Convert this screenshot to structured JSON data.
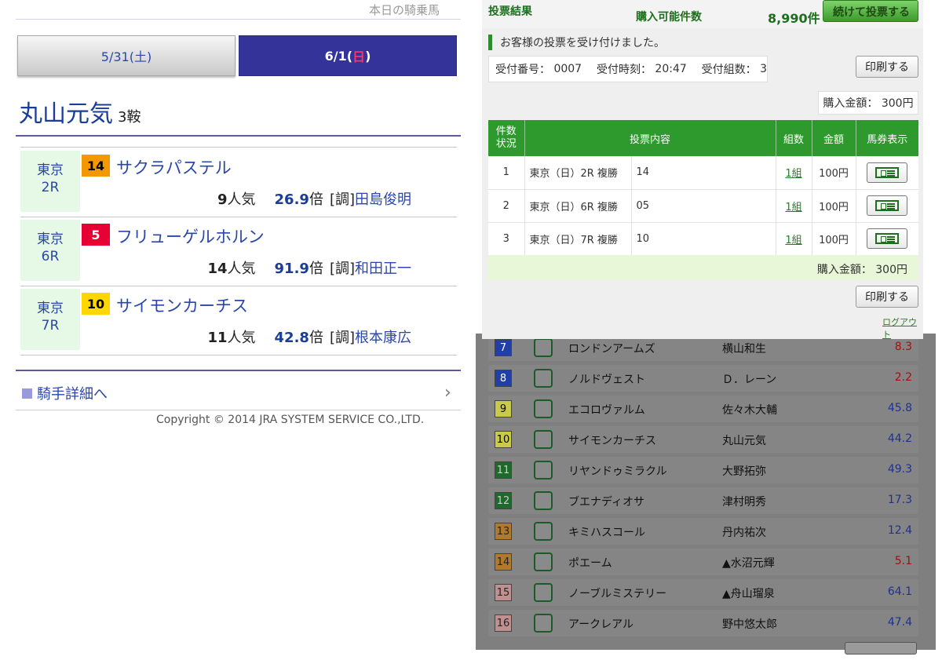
{
  "left": {
    "top_cut_text": "本日の騎乗馬",
    "tabs": [
      {
        "label": "5/31(土)"
      },
      {
        "label_pre": "6/1(",
        "label_day": "日",
        "label_post": ")"
      }
    ],
    "jockey": {
      "name": "丸山元気",
      "mounts": "3鞍"
    },
    "races": [
      {
        "track": "東京",
        "race": "2R",
        "num": "14",
        "num_bg": "#f39800",
        "num_fg": "#000000",
        "horse": "サクラパステル",
        "pop": "9",
        "pop_unit": "人気",
        "odds": "26.9",
        "odds_unit": "倍",
        "trainer_tag": "[調]",
        "trainer": "田島俊明"
      },
      {
        "track": "東京",
        "race": "6R",
        "num": "5",
        "num_bg": "#e60033",
        "num_fg": "#ffffff",
        "horse": "フリューゲルホルン",
        "pop": "14",
        "pop_unit": "人気",
        "odds": "91.9",
        "odds_unit": "倍",
        "trainer_tag": "[調]",
        "trainer": "和田正一"
      },
      {
        "track": "東京",
        "race": "7R",
        "num": "10",
        "num_bg": "#ffd700",
        "num_fg": "#000000",
        "horse": "サイモンカーチス",
        "pop": "11",
        "pop_unit": "人気",
        "odds": "42.8",
        "odds_unit": "倍",
        "trainer_tag": "[調]",
        "trainer": "根本康広"
      }
    ],
    "detail_link": "騎手詳細へ",
    "copyright": "Copyright © 2014 JRA SYSTEM SERVICE CO.,LTD."
  },
  "modal": {
    "title": "投票結果",
    "avail_label": "購入可能件数",
    "avail_value": "8,990件",
    "continue_label": "続けて投票する",
    "accept_msg": "お客様の投票を受け付けました。",
    "receipt": {
      "no_label": "受付番号：",
      "no": "0007",
      "time_label": "受付時刻：",
      "time": "20:47",
      "sets_label": "受付組数：",
      "sets": "3"
    },
    "print_label": "印刷する",
    "total_top": "購入金額： 300円",
    "headers": {
      "status": "件数\n状況",
      "content": "投票内容",
      "units": "組数",
      "amount": "金額",
      "ticket": "馬券表示"
    },
    "bets": [
      {
        "n": "1",
        "race": "東京（日）2R 複勝",
        "sel": "14",
        "units": "1組",
        "amount": "100円"
      },
      {
        "n": "2",
        "race": "東京（日）6R 複勝",
        "sel": "05",
        "units": "1組",
        "amount": "100円"
      },
      {
        "n": "3",
        "race": "東京（日）7R 複勝",
        "sel": "10",
        "units": "1組",
        "amount": "100円"
      }
    ],
    "total_bottom": "購入金額： 300円",
    "print_label2": "印刷する",
    "logout": "ログアウト"
  },
  "bg_rows": [
    {
      "num": "7",
      "num_bg": "#2040a8",
      "num_fg": "#ffffff",
      "horse": "ロンドンアームズ",
      "jockey": "横山和生",
      "odds": "8.3",
      "odds_color": "#a01010"
    },
    {
      "num": "8",
      "num_bg": "#2040a8",
      "num_fg": "#ffffff",
      "horse": "ノルドヴェスト",
      "jockey": "Ｄ．レーン",
      "odds": "2.2",
      "odds_color": "#a01010"
    },
    {
      "num": "9",
      "num_bg": "#c9c94a",
      "num_fg": "#000000",
      "horse": "エコロヴァルム",
      "jockey": "佐々木大輔",
      "odds": "45.8",
      "odds_color": "#203090"
    },
    {
      "num": "10",
      "num_bg": "#c9c94a",
      "num_fg": "#000000",
      "horse": "サイモンカーチス",
      "jockey": "丸山元気",
      "odds": "44.2",
      "odds_color": "#203090"
    },
    {
      "num": "11",
      "num_bg": "#1e6a2a",
      "num_fg": "#cccccc",
      "horse": "リヤンドゥミラクル",
      "jockey": "大野拓弥",
      "odds": "49.3",
      "odds_color": "#203090"
    },
    {
      "num": "12",
      "num_bg": "#1e6a2a",
      "num_fg": "#cccccc",
      "horse": "ブエナディオサ",
      "jockey": "津村明秀",
      "odds": "17.3",
      "odds_color": "#203090"
    },
    {
      "num": "13",
      "num_bg": "#b07a2a",
      "num_fg": "#222222",
      "horse": "キミハスコール",
      "jockey": "丹内祐次",
      "odds": "12.4",
      "odds_color": "#203090"
    },
    {
      "num": "14",
      "num_bg": "#b07a2a",
      "num_fg": "#222222",
      "horse": "ポエーム",
      "jockey": "▲水沼元輝",
      "odds": "5.1",
      "odds_color": "#a01010"
    },
    {
      "num": "15",
      "num_bg": "#c09090",
      "num_fg": "#222222",
      "horse": "ノーブルミステリー",
      "jockey": "▲舟山瑠泉",
      "odds": "64.1",
      "odds_color": "#203090"
    },
    {
      "num": "16",
      "num_bg": "#c09090",
      "num_fg": "#222222",
      "horse": "アークレアル",
      "jockey": "野中悠太郎",
      "odds": "47.4",
      "odds_color": "#203090"
    }
  ]
}
